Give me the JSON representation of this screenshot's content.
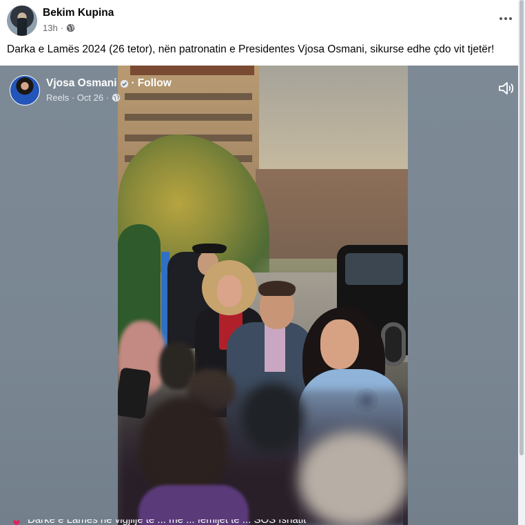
{
  "post": {
    "author": "Bekim Kupina",
    "time": "13h",
    "audience_icon": "globe-icon",
    "more_icon": "more-horizontal-icon",
    "text": "Darka e Lamës 2024 (26 tetor), nën patronatin e Presidentes Vjosa Osmani, sikurse edhe çdo vit tjetër!"
  },
  "reel": {
    "author": "Vjosa Osmani",
    "verified_icon": "verified-badge-icon",
    "separator": "·",
    "follow": "Follow",
    "meta": "Reels · Oct 26 ·",
    "audience_icon": "globe-icon",
    "sound_icon": "speaker-icon"
  },
  "caption": {
    "icon": "heart-icon",
    "text": "Darkë e Lamës në vigjilje të ... më ... fëmijët të ... SOS fshatit"
  },
  "colors": {
    "text_primary": "#050505",
    "text_secondary": "#65676b",
    "media_background": "#7a8793",
    "caption_heart": "#e0245e"
  }
}
